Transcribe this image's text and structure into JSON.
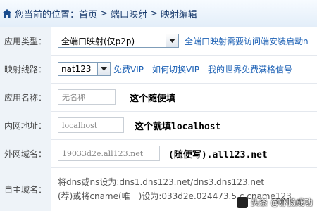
{
  "breadcrumb": {
    "prefix": "您当前的位置：",
    "items": [
      "首页",
      "端口映射",
      "映射编辑"
    ],
    "separator": ">"
  },
  "form": {
    "app_type": {
      "label": "应用类型：",
      "selected": "全端口映射(仅p2p)",
      "hint": "全端口映射需要访问端安装启动n"
    },
    "line": {
      "label": "映射线路：",
      "selected": "nat123",
      "links": [
        "免费VIP",
        "如何切换VIP",
        "我的世界免费满格信号"
      ]
    },
    "app_name": {
      "label": "应用名称：",
      "placeholder": "无名称",
      "note": "这个随便填"
    },
    "lan_addr": {
      "label": "内网地址：",
      "placeholder": "localhost",
      "note": "这个就填localhost"
    },
    "wan_domain": {
      "label": "外网域名：",
      "placeholder": "19033d2e.all123.net",
      "note": "(随便写).all123.net"
    },
    "own_domain": {
      "label": "自主域名：",
      "line1": "将dns或ns设为:dns1.dns123.net/dns3.dns123.net",
      "line2": "(荐)或将cname(唯一)设为:033d2e.024473.5.c.cname123."
    }
  },
  "watermark": "头条 @亦扬成功",
  "colors": {
    "accent": "#1a5fb4",
    "label_bg": "#eef3f8"
  }
}
